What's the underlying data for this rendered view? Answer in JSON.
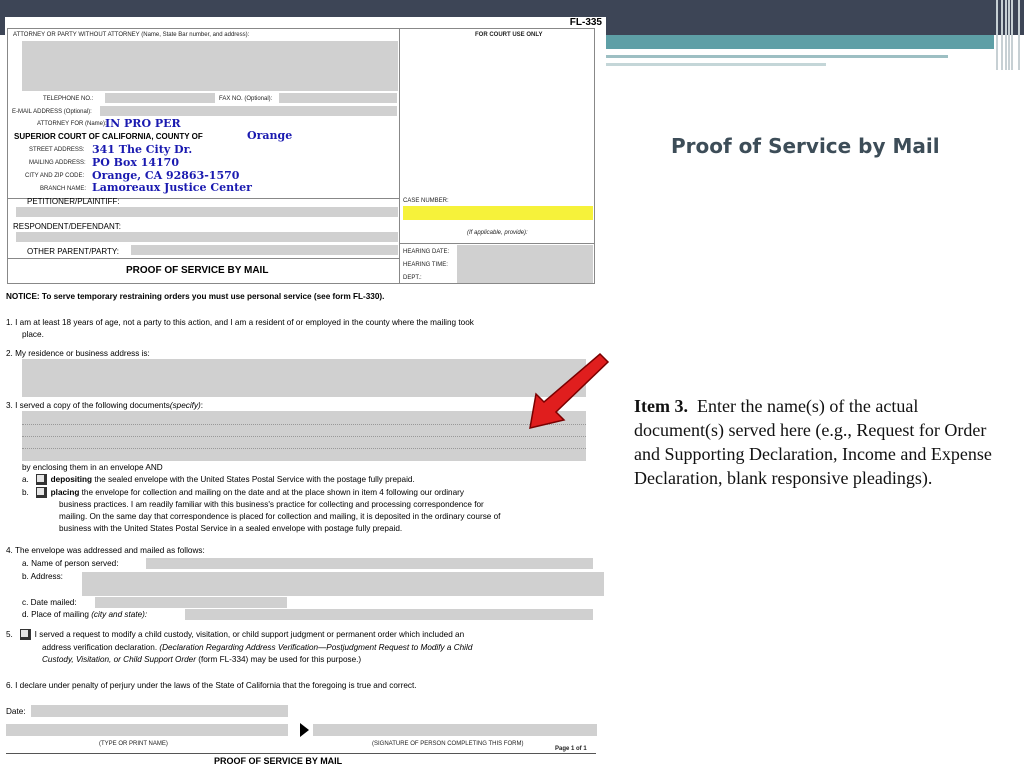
{
  "slide": {
    "title": "Proof of Service by Mail",
    "note_item": "Item 3.",
    "note_text": "Enter the name(s) of the actual document(s) served here (e.g., Request for Order and Supporting Declaration, Income and Expense Declaration, blank responsive pleadings)."
  },
  "form": {
    "code": "FL-335",
    "attorney_header": "ATTORNEY OR PARTY WITHOUT ATTORNEY (Name, State Bar number, and address):",
    "court_use": "FOR COURT USE ONLY",
    "telephone": "TELEPHONE NO.:",
    "fax": "FAX NO. (Optional):",
    "email": "E-MAIL ADDRESS (Optional):",
    "attorney_for": "ATTORNEY FOR (Name):",
    "attorney_for_value": "IN PRO PER",
    "court_label": "SUPERIOR COURT OF CALIFORNIA, COUNTY OF",
    "county_value": "Orange",
    "street_label": "STREET ADDRESS:",
    "street_value": "341 The City Dr.",
    "mailing_label": "MAILING ADDRESS:",
    "mailing_value": "PO Box 14170",
    "city_label": "CITY AND ZIP CODE:",
    "city_value": "Orange, CA  92863-1570",
    "branch_label": "BRANCH NAME:",
    "branch_value": "Lamoreaux Justice Center",
    "petitioner": "PETITIONER/PLAINTIFF:",
    "respondent": "RESPONDENT/DEFENDANT:",
    "other_parent": "OTHER PARENT/PARTY:",
    "case_number": "CASE NUMBER:",
    "if_applicable": "(If applicable, provide):",
    "hearing_date": "HEARING DATE:",
    "hearing_time": "HEARING TIME:",
    "dept": "DEPT.:",
    "doc_title": "PROOF OF SERVICE BY MAIL",
    "notice": "NOTICE: To serve temporary restraining orders you must use personal service (see form FL-330).",
    "item1_a": "1.   I am at least 18 years of age, not a party to this action, and I am a resident of or employed in the county where the mailing took",
    "item1_b": "place.",
    "item2": "2.   My residence or business address is:",
    "item3_lead": "3.   I served a copy of the following documents",
    "item3_specify": "(specify)",
    "item3_colon": ":",
    "enclosing": "by enclosing them in an envelope AND",
    "a_label": "a.",
    "a_bold": "depositing",
    "a_text": " the sealed envelope with the United States Postal Service with the postage fully prepaid.",
    "b_label": "b.",
    "b_bold": "placing",
    "b_text1": " the envelope for collection and mailing on the date and at the place shown in item 4 following our ordinary",
    "b_text2": "business practices. I am readily familiar with this business's practice for collecting and processing correspondence for",
    "b_text3": "mailing. On the same day that correspondence is placed for collection and mailing, it is deposited in the ordinary course of",
    "b_text4": "business with the United States Postal Service in a sealed envelope with postage fully prepaid.",
    "item4": "4.   The envelope was addressed and mailed as follows:",
    "item4a": "a.   Name of person served:",
    "item4b": "b.   Address:",
    "item4c": "c.   Date mailed:",
    "item4d_lead": "d.   Place of mailing",
    "item4d_italic": "(city and state):",
    "item5_num": "5.",
    "item5_text1": "I served a request to modify a child custody, visitation, or child support judgment or permanent order which included an",
    "item5_text2_plain": "address verification declaration. ",
    "item5_text2_italic": "(Declaration Regarding Address Verification—Postjudgment Request to Modify a Child",
    "item5_text3_italic": "Custody, Visitation, or Child Support Order",
    "item5_text3_plain": " (form FL-334) may be used for this purpose.)",
    "item6": "6.   I declare under penalty of perjury under the laws of the State of California that the foregoing is true and correct.",
    "date_label": "Date:",
    "type_name": "(TYPE OR PRINT NAME)",
    "signature": "(SIGNATURE OF PERSON COMPLETING THIS FORM)",
    "page": "Page 1 of 1",
    "footer_title": "PROOF OF SERVICE BY MAIL"
  }
}
